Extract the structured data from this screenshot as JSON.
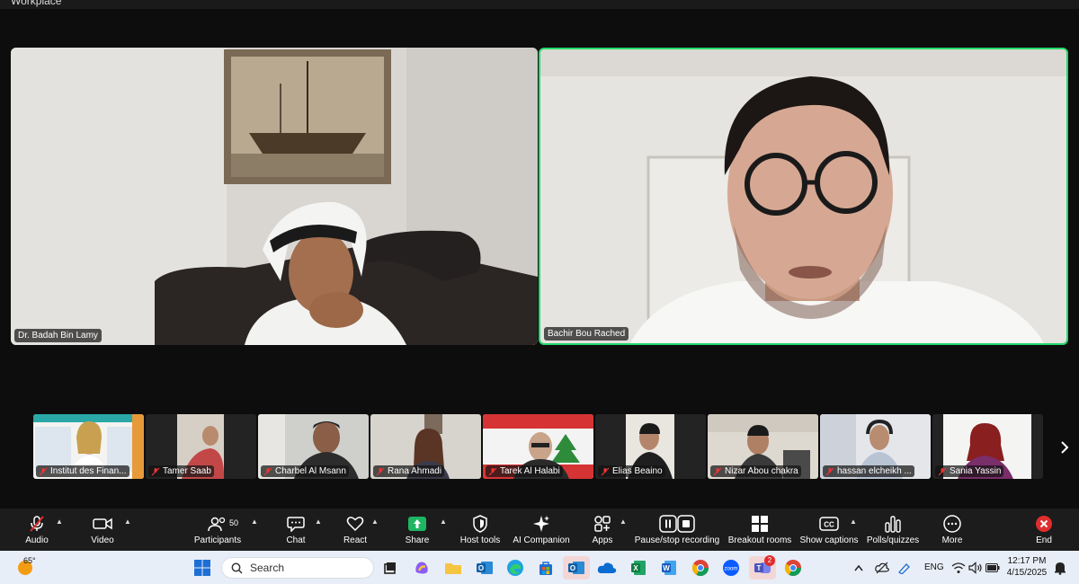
{
  "window": {
    "title": "Workplace"
  },
  "main_tiles": [
    {
      "name": "Dr. Badah Bin Lamy"
    },
    {
      "name": "Bachir Bou Rached"
    }
  ],
  "strip": [
    {
      "name": "Institut des Finan..."
    },
    {
      "name": "Tamer Saab"
    },
    {
      "name": "Charbel Al Msann"
    },
    {
      "name": "Rana Ahmadi"
    },
    {
      "name": "Tarek Al Halabi"
    },
    {
      "name": "Elias Beaino"
    },
    {
      "name": "Nizar Abou chakra"
    },
    {
      "name": "hassan elcheikh ..."
    },
    {
      "name": "Sania Yassin"
    }
  ],
  "toolbar": {
    "audio": "Audio",
    "video": "Video",
    "participants": "Participants",
    "participants_count": "50",
    "chat": "Chat",
    "react": "React",
    "share": "Share",
    "host_tools": "Host tools",
    "ai_companion": "AI Companion",
    "apps": "Apps",
    "recording": "Pause/stop recording",
    "breakout": "Breakout rooms",
    "captions": "Show captions",
    "polls": "Polls/quizzes",
    "more": "More",
    "end": "End"
  },
  "taskbar": {
    "weather": "65°",
    "search_placeholder": "Search",
    "teams_badge": "2",
    "language": "ENG",
    "time": "12:17 PM",
    "date": "4/15/2025"
  },
  "colors": {
    "active_speaker": "#23d96b",
    "share_green": "#1fb562",
    "end_red": "#e02d2d",
    "toolbar_bg": "#1c1c1c",
    "taskbar_bg": "#e8eef7"
  }
}
